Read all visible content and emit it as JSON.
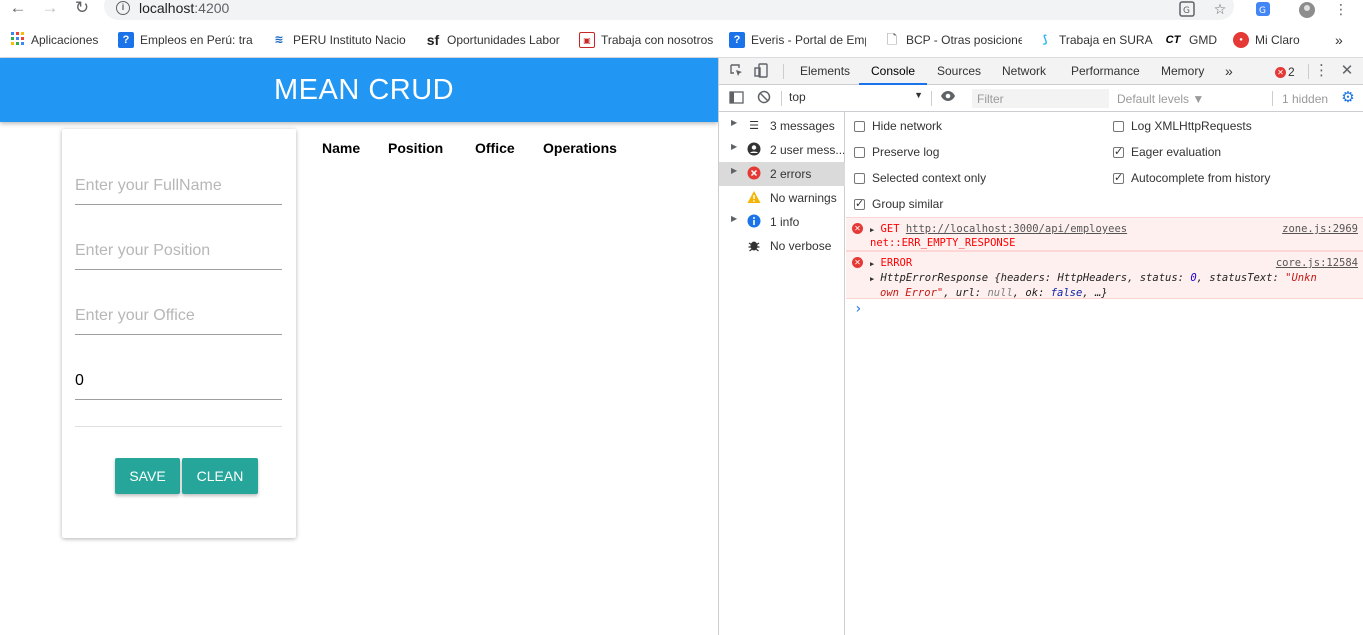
{
  "browser": {
    "url_host": "localhost",
    "url_port": ":4200",
    "bookmarks": [
      {
        "label": "Aplicaciones",
        "icon": "apps-grid-icon",
        "color": "#4285f4"
      },
      {
        "label": "Empleos en Perú: trab",
        "icon": "question-icon",
        "color": "#1a73e8"
      },
      {
        "label": "PERU Instituto Nacio",
        "icon": "peru-logo-icon",
        "color": "#1565c0"
      },
      {
        "label": "Oportunidades Labor",
        "icon": "sf-logo-icon",
        "color": "#222222"
      },
      {
        "label": "Trabaja con nosotros",
        "icon": "box-icon",
        "color": "#c62828"
      },
      {
        "label": "Everis - Portal de Emp",
        "icon": "question-icon",
        "color": "#1a73e8"
      },
      {
        "label": "BCP - Otras posicione",
        "icon": "page-icon",
        "color": "#5f6368"
      },
      {
        "label": "Trabaja en SURA",
        "icon": "sura-logo-icon",
        "color": "#29b6f6"
      },
      {
        "label": "GMD",
        "icon": "ct-logo-icon",
        "color": "#000000"
      },
      {
        "label": "Mi Claro",
        "icon": "claro-logo-icon",
        "color": "#e53935"
      }
    ],
    "more_bookmarks": "»"
  },
  "app": {
    "title": "MEAN CRUD",
    "header_color": "#2196f3",
    "form": {
      "fullname_placeholder": "Enter your FullName",
      "position_placeholder": "Enter your Position",
      "office_placeholder": "Enter your Office",
      "salary_value": "0",
      "save_label": "SAVE",
      "clean_label": "CLEAN",
      "button_color": "#26a69a"
    },
    "table": {
      "headers": [
        "Name",
        "Position",
        "Office",
        "Operations"
      ]
    }
  },
  "devtools": {
    "tabs": [
      "Elements",
      "Console",
      "Sources",
      "Network",
      "Performance",
      "Memory"
    ],
    "active_tab": "Console",
    "more_tabs": "»",
    "error_count": "2",
    "context": "top",
    "filter_placeholder": "Filter",
    "levels": "Default levels ▼",
    "hidden": "1 hidden",
    "sidebar": [
      {
        "label": "3 messages",
        "icon": "list-icon"
      },
      {
        "label": "2 user mess...",
        "icon": "user-icon"
      },
      {
        "label": "2 errors",
        "icon": "error-icon"
      },
      {
        "label": "No warnings",
        "icon": "warning-icon"
      },
      {
        "label": "1 info",
        "icon": "info-icon"
      },
      {
        "label": "No verbose",
        "icon": "bug-icon"
      }
    ],
    "settings": {
      "hide_network": "Hide network",
      "preserve_log": "Preserve log",
      "selected_context": "Selected context only",
      "group_similar": "Group similar",
      "log_xhr": "Log XMLHttpRequests",
      "eager_eval": "Eager evaluation",
      "autocomplete": "Autocomplete from history"
    },
    "logs": {
      "get_method": "GET",
      "get_url": "http://localhost:3000/api/employees",
      "get_source": "zone.js:2969",
      "get_error": "net::ERR_EMPTY_RESPONSE",
      "error_label": "ERROR",
      "error_source": "core.js:12584",
      "error_obj_prefix": "HttpErrorResponse {headers: HttpHeaders, status: ",
      "error_status": "0",
      "error_mid": ", statusText: ",
      "error_status_text_1": "\"Unkn",
      "error_status_text_2": "own Error\"",
      "error_rest_1": ", url: ",
      "error_null": "null",
      "error_rest_2": ", ok: ",
      "error_false": "false",
      "error_rest_3": ", …}",
      "prompt": "›"
    }
  }
}
